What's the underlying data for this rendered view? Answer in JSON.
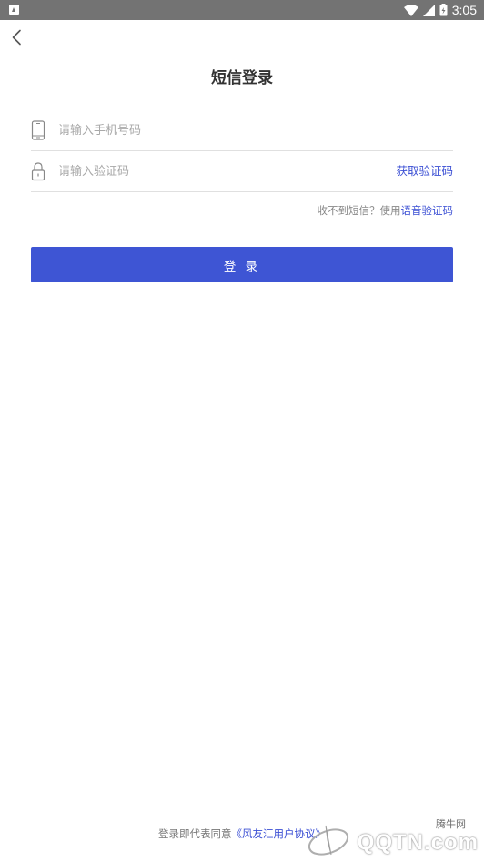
{
  "status_bar": {
    "time": "3:05"
  },
  "header": {
    "title": "短信登录"
  },
  "form": {
    "phone_placeholder": "请输入手机号码",
    "code_placeholder": "请输入验证码",
    "get_code_label": "获取验证码",
    "help_prefix": "收不到短信？使用",
    "help_link": "语音验证码",
    "login_label": "登 录"
  },
  "footer": {
    "agreement_prefix": "登录即代表同意",
    "agreement_link": "《风友汇用户协议》"
  },
  "watermark": {
    "cn": "腾牛网",
    "en": "QQTN.com"
  },
  "colors": {
    "accent": "#3e55d4",
    "link": "#3b4fd4",
    "status_bar": "#737373"
  }
}
